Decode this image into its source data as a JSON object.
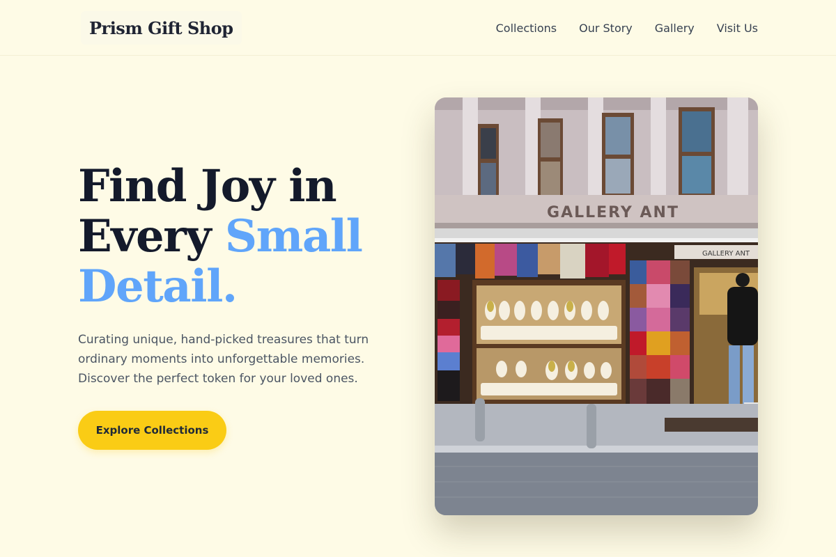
{
  "header": {
    "logo": "Prism Gift Shop",
    "nav": [
      "Collections",
      "Our Story",
      "Gallery",
      "Visit Us"
    ]
  },
  "hero": {
    "headline_line1": "Find Joy in",
    "headline_line2_plain": "Every ",
    "headline_line2_accent": "Small",
    "headline_line3_accent": "Detail.",
    "subtext": "Curating unique, hand-picked treasures that turn ordinary moments into unforgettable memories. Discover the perfect token for your loved ones.",
    "cta_label": "Explore Collections"
  },
  "photo": {
    "sign_text": "GALLERY ANT",
    "small_sign_text": "GALLERY ANT"
  },
  "colors": {
    "background": "#fefbe6",
    "accent_blue": "#60a5fa",
    "cta_yellow": "#facc15",
    "heading_dark": "#141a2b"
  }
}
